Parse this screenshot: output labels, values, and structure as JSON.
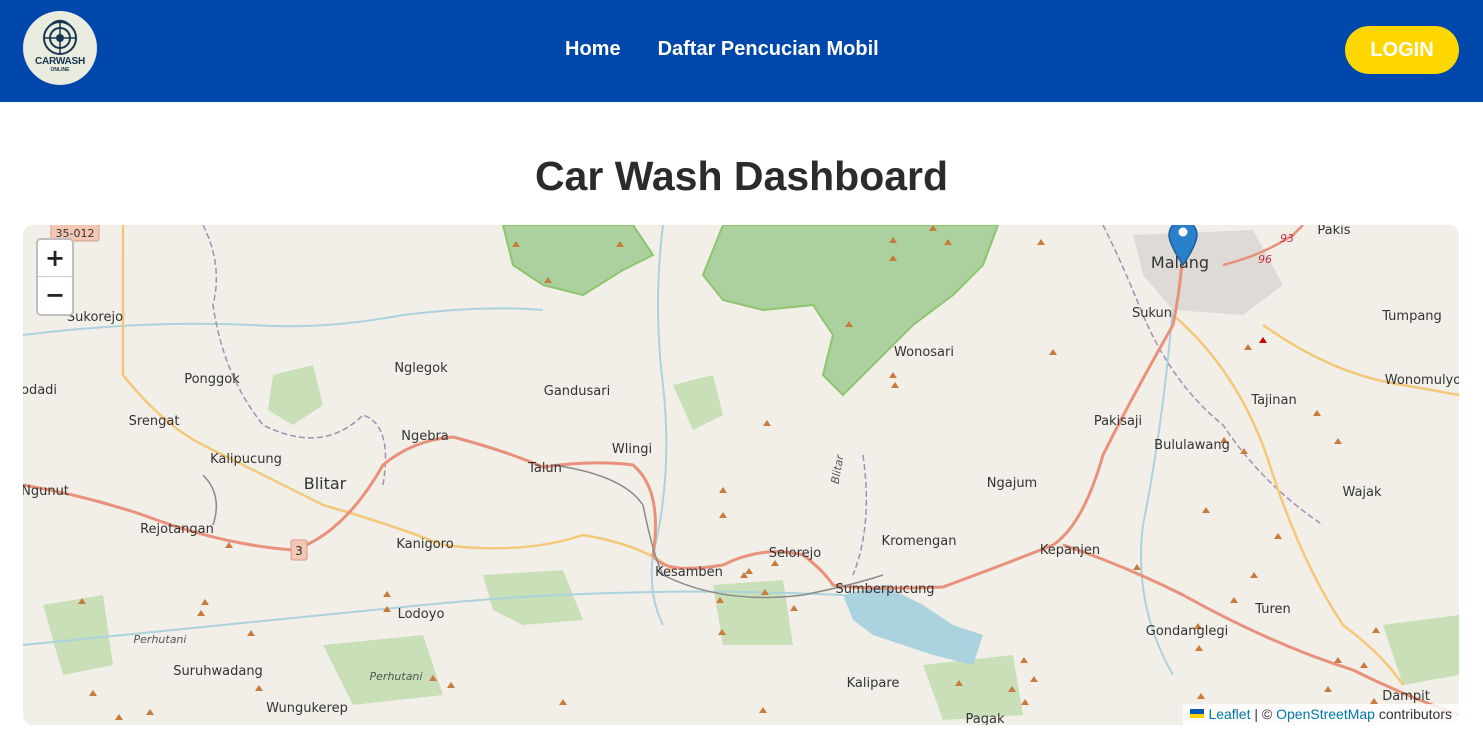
{
  "header": {
    "logo": {
      "text": "CARWASH",
      "subtext": "ONLINE"
    },
    "nav": [
      {
        "label": "Home"
      },
      {
        "label": "Daftar Pencucian Mobil"
      }
    ],
    "login_label": "LOGIN"
  },
  "page": {
    "title": "Car Wash Dashboard"
  },
  "map": {
    "zoom_in_label": "+",
    "zoom_out_label": "−",
    "attribution": {
      "leaflet": "Leaflet",
      "separator": "| ©",
      "osm": "OpenStreetMap",
      "contributors": "contributors"
    },
    "marker": {
      "icon": "map-pin-icon",
      "color": "#2A81CB"
    },
    "place_labels": {
      "malang": "Malang",
      "pakis": "Pakis",
      "sukun": "Sukun",
      "tumpang": "Tumpang",
      "wonomulyo": "Wonomulyo",
      "tajinan": "Tajinan",
      "pakisaji": "Pakisaji",
      "bululawang": "Bululawang",
      "wajak": "Wajak",
      "ngajum": "Ngajum",
      "kepanjen": "Kepanjen",
      "kromengan": "Kromengan",
      "turen": "Turen",
      "gondanglegi": "Gondanglegi",
      "dampit": "Dampit",
      "pagak": "Pagak",
      "kalipare": "Kalipare",
      "sumberpucung": "Sumberpucung",
      "selorejo": "Selorejo",
      "kesamben": "Kesamben",
      "wonosari": "Wonosari",
      "wlingi": "Wlingi",
      "talun": "Talun",
      "gandusari": "Gandusari",
      "nglegok": "Nglegok",
      "ngebra": "Ngebra",
      "blitar": "Blitar",
      "kalipucung": "Kalipucung",
      "kanigoro": "Kanigoro",
      "lodoyo": "Lodoyo",
      "suruhwadang": "Suruhwadang",
      "wungukerep": "Wungukerep",
      "rejotangan": "Rejotangan",
      "ngunut": "Ngunut",
      "srengat": "Srengat",
      "ponggok": "Ponggok",
      "sukorejo": "Sukorejo",
      "kodadi": "odadi",
      "perhutani": "Perhutani",
      "perhutani2": "Perhutani",
      "blitar_road": "Blitar"
    },
    "road_shields": {
      "r35": "35-012",
      "r3": "3",
      "r93": "93",
      "r96": "96"
    },
    "colors": {
      "land": "#f2efe9",
      "forest": "#add19e",
      "forest_dark": "#8dc56c",
      "water": "#aad3df",
      "road_primary": "#e8917b",
      "road_secondary": "#f5c879",
      "boundary": "#a48fb3",
      "peak": "#c87b3a"
    }
  }
}
